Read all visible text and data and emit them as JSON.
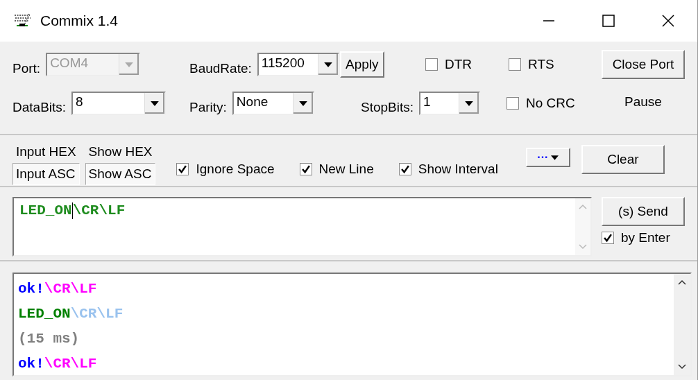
{
  "window": {
    "title": "Commix 1.4"
  },
  "settings_row_1": [
    {
      "kind": "combo",
      "label": "Port:",
      "value": "COM4",
      "disabled": true
    },
    {
      "kind": "combo",
      "label": "BaudRate:",
      "value": "115200",
      "disabled": false
    },
    {
      "kind": "button",
      "label": "Apply"
    },
    {
      "kind": "checkbox",
      "label": "DTR",
      "checked": false
    },
    {
      "kind": "checkbox",
      "label": "RTS",
      "checked": false
    }
  ],
  "settings_row_2": [
    {
      "kind": "combo",
      "label": "DataBits:",
      "value": "8",
      "disabled": false
    },
    {
      "kind": "combo",
      "label": "Parity:",
      "value": "None",
      "disabled": false
    },
    {
      "kind": "combo",
      "label": "StopBits:",
      "value": "1",
      "disabled": false
    },
    {
      "kind": "checkbox",
      "label": "No CRC",
      "checked": false
    }
  ],
  "close_port_button": "Close Port",
  "pause_label": "Pause",
  "input_mode": [
    {
      "label": "Input HEX",
      "selected": false
    },
    {
      "label": "Input ASC",
      "selected": true
    }
  ],
  "show_mode": [
    {
      "label": "Show HEX",
      "selected": false
    },
    {
      "label": "Show ASC",
      "selected": true
    }
  ],
  "options": [
    {
      "label": "Ignore Space",
      "checked": true
    },
    {
      "label": "New Line",
      "checked": true
    },
    {
      "label": "Show Interval",
      "checked": true
    }
  ],
  "more_button": "···",
  "clear_button": "Clear",
  "input": {
    "segments": [
      {
        "text": "LED_ON",
        "color": "#1e8c1e"
      },
      {
        "text": "\\CR\\LF",
        "color": "#1e8c1e"
      }
    ]
  },
  "send_button": "(s)  Send",
  "by_enter": {
    "label": "by Enter",
    "checked": true
  },
  "output_lines": [
    {
      "segments": [
        {
          "text": "ok!",
          "color": "#0000ff"
        },
        {
          "text": "\\CR\\LF",
          "color": "#ff00ff"
        }
      ]
    },
    {
      "segments": [
        {
          "text": "LED_ON",
          "color": "#008000"
        },
        {
          "text": "\\CR\\LF",
          "color": "#99c2ee"
        }
      ]
    },
    {
      "segments": [
        {
          "text": "(15 ms)",
          "color": "#808080"
        }
      ]
    },
    {
      "segments": [
        {
          "text": "ok!",
          "color": "#0000ff"
        },
        {
          "text": "\\CR\\LF",
          "color": "#ff00ff"
        }
      ]
    }
  ]
}
